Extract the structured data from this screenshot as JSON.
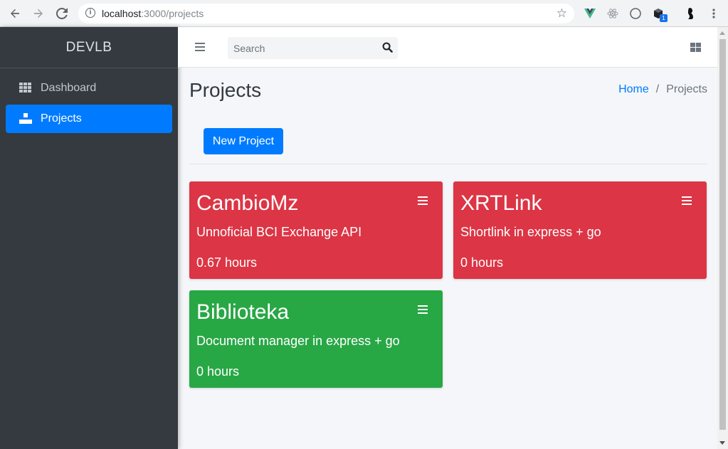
{
  "browser": {
    "url_host": "localhost",
    "url_path": ":3000/projects",
    "extension_badge": "1"
  },
  "sidebar": {
    "brand": "DEVLB",
    "items": [
      {
        "label": "Dashboard",
        "icon": "th-grid-icon",
        "active": false
      },
      {
        "label": "Projects",
        "icon": "cubes-icon",
        "active": true
      }
    ]
  },
  "topbar": {
    "search_placeholder": "Search"
  },
  "page": {
    "title": "Projects",
    "breadcrumb": {
      "home": "Home",
      "current": "Projects",
      "separator": "/"
    },
    "new_project_label": "New Project"
  },
  "projects": [
    {
      "name": "CambioMz",
      "description": "Unnoficial BCI Exchange API",
      "hours": "0.67 hours",
      "color": "#dc3545"
    },
    {
      "name": "XRTLink",
      "description": "Shortlink in express + go",
      "hours": "0 hours",
      "color": "#dc3545"
    },
    {
      "name": "Biblioteka",
      "description": "Document manager in express + go",
      "hours": "0 hours",
      "color": "#28a745"
    }
  ],
  "colors": {
    "primary": "#007bff",
    "sidebar_bg": "#343a40",
    "danger": "#dc3545",
    "success": "#28a745"
  }
}
